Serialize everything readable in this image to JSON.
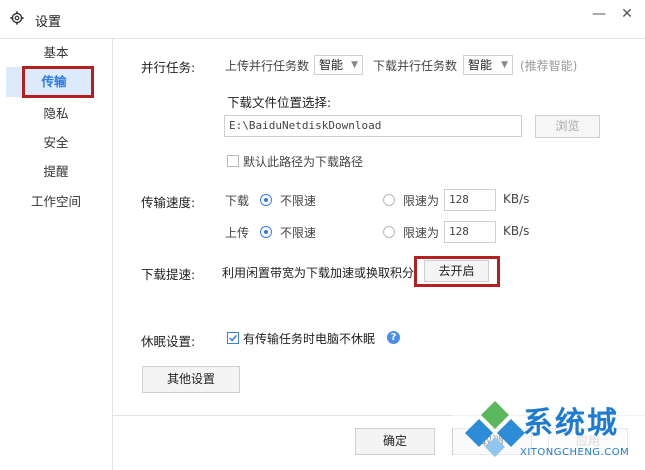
{
  "window": {
    "title": "设置"
  },
  "sidebar": {
    "items": [
      {
        "label": "基本"
      },
      {
        "label": "传输"
      },
      {
        "label": "隐私"
      },
      {
        "label": "安全"
      },
      {
        "label": "提醒"
      },
      {
        "label": "工作空间"
      }
    ],
    "active": "传输"
  },
  "parallel": {
    "label": "并行任务:",
    "upload_label": "上传并行任务数",
    "upload_value": "智能",
    "download_label": "下载并行任务数",
    "download_value": "智能",
    "hint": "(推荐智能)"
  },
  "download_location": {
    "label": "下载文件位置选择:",
    "path": "E:\\BaiduNetdiskDownload",
    "browse": "浏览",
    "default_checkbox": "默认此路径为下载路径",
    "default_checked": false
  },
  "speed": {
    "label": "传输速度:",
    "download": {
      "label": "下载",
      "unlimited": "不限速",
      "limit": "限速为",
      "value": "128",
      "unit": "KB/s",
      "selected": "unlimited"
    },
    "upload": {
      "label": "上传",
      "unlimited": "不限速",
      "limit": "限速为",
      "value": "128",
      "unit": "KB/s",
      "selected": "unlimited"
    }
  },
  "boost": {
    "label": "下载提速:",
    "desc": "利用闲置带宽为下载加速或换取积分",
    "button": "去开启"
  },
  "sleep": {
    "label": "休眠设置:",
    "checkbox": "有传输任务时电脑不休眠",
    "checked": true
  },
  "other_button": "其他设置",
  "footer": {
    "ok": "确定",
    "cancel": "取消",
    "apply": "应用"
  },
  "watermark": {
    "title": "系统城",
    "url": "XITONGCHENG.COM"
  },
  "colors": {
    "accent": "#2d7be5",
    "highlight": "#b51f1f",
    "active_bg": "#dceafb"
  }
}
